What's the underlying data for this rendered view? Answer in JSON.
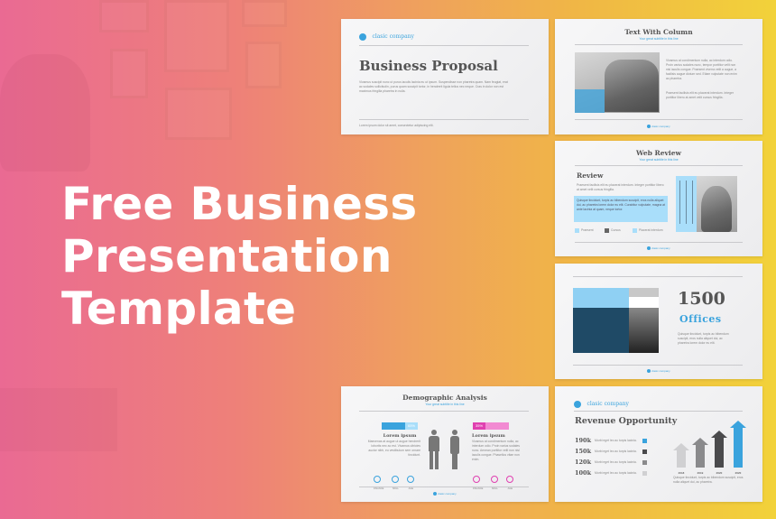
{
  "hero": {
    "lines": [
      "Free Business",
      "Presentation",
      "Template"
    ]
  },
  "colors": {
    "accent_blue": "#3aa3dd",
    "accent_pink": "#e040b0",
    "gradient_start": "#ea6a93",
    "gradient_end": "#f2d23a"
  },
  "slides": {
    "business_proposal": {
      "logo": "clasic company",
      "title": "Business Proposal",
      "body": "Vivamus suscipit nunc ut purus iaculis lacinia eu ut ipsum. Suspendisse non pharetra quam. Nam feugiat, erat ac sodales sollicitudin, purus quam suscipit tortor, in hendrerit ligula tellus nec neque. Cras in dolor non est maximus fringilla pharetra in nulla.",
      "footer": "Lorem ipsum dolor sit amet, consectetur adipiscing elit."
    },
    "text_with_column": {
      "title": "Text With Column",
      "subtitle": "Your great subtitle in this line",
      "para1": "Vivamus at condimentum nulla, ac interdum odio. Proin varius sodales nunc, tempor porttitor velit non nisl iaculis congue. Praesent viverra velit a augue, a facilisis augue dictum sed. Etiam vulputate non enim ac pharetra.",
      "para2": "Praesent facilisis elit eu placerat interdum. Integer porttitor libero at amet velit cursus fringilla.",
      "footer_logo": "clasic company"
    },
    "web_review": {
      "title": "Web Review",
      "subtitle": "Your great subtitle in this line",
      "heading": "Review",
      "intro": "Praesent facilisis elit eu placerat interdum. Integer porttitor libero at amet velit cursus fringilla.",
      "highlight": "Quisque tincidunt, turpis ac bibendum suscipit, eros nulla aliquet dui, ac pharetra lorem dolor eu elit. Curabitur vulputate, magna at ante lacinia at quam, neque tortor.",
      "checks": [
        "Praesent",
        "Cursus",
        "Placerat interdum"
      ],
      "footer_logo": "clasic company"
    },
    "offices": {
      "number": "1500",
      "label": "Offices",
      "body": "Quisque tincidunt, turpis ac bibendum suscipit, eros nulla aliquet dui, ac pharetra lorem dolor eu elit.",
      "footer_logo": "clasic company"
    },
    "demographic": {
      "title": "Demographic Analysis",
      "subtitle": "Your great subtitle in this line",
      "left": {
        "percent": "65%",
        "percent_value": 65,
        "heading": "Lorem ipsum",
        "body": "Maecenas at augue ut augue hendrerit lobortis nec ac est. Vivamus ultricies auctor nibh, eu vestibulum sem ornare tincidunt.",
        "rings": [
          "FINANCE",
          "SKILL",
          "AGE"
        ]
      },
      "right": {
        "percent": "35%",
        "percent_value": 35,
        "heading": "Lorem ipsum",
        "body": "Vivamus at condimentum nulla, ac interdum odio. Proin varius sodales nunc. Aenean porttitor velit non nisl iaculis congue. Phasellus vitae non enim.",
        "rings": [
          "FINANCE",
          "SKILL",
          "AGE"
        ]
      },
      "footer_logo": "clasic company"
    },
    "revenue": {
      "logo": "clasic company",
      "title": "Revenue Opportunity",
      "rows": [
        {
          "value": "190k",
          "text": "Morbi eget leo ac turpis lacinia.",
          "color": "#3aa3dd"
        },
        {
          "value": "150k",
          "text": "Morbi eget leo ac turpis lacinia.",
          "color": "#4a4a4c"
        },
        {
          "value": "120k",
          "text": "Morbi eget leo ac turpis lacinia.",
          "color": "#8a8a8c"
        },
        {
          "value": "100k",
          "text": "Morbi eget leo ac turpis lacinia.",
          "color": "#d0d0d2"
        }
      ],
      "bars": [
        {
          "year": "2018",
          "value": 100,
          "color": "#d0d0d2"
        },
        {
          "year": "2019",
          "value": 120,
          "color": "#8a8a8c"
        },
        {
          "year": "2020",
          "value": 150,
          "color": "#4a4a4c"
        },
        {
          "year": "2020",
          "value": 190,
          "color": "#3aa3dd"
        }
      ],
      "caption": "Quisque tincidunt, turpis ac bibendum suscipit, eros nulla aliquet dui, ac pharetra."
    }
  }
}
